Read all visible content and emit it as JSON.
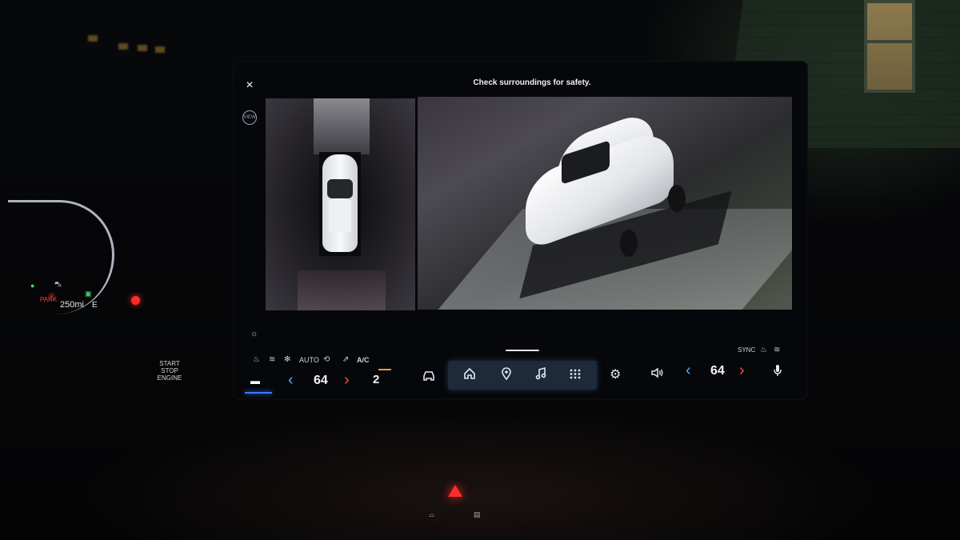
{
  "screen": {
    "message": "Check surroundings for safety.",
    "close_icon": "×",
    "view_toggle_label": "VIEW"
  },
  "climate": {
    "auto_label": "AUTO",
    "ac_label": "A/C",
    "sync_label": "SYNC",
    "driver_temp": "64",
    "passenger_temp": "64",
    "fan_speed": "2"
  },
  "dock": {
    "items": [
      "home-icon",
      "location-pin-icon",
      "music-note-icon",
      "apps-grid-icon"
    ]
  },
  "cluster": {
    "park_label": "PARK",
    "range": "250mi",
    "fuel_label": "E"
  },
  "start_button": {
    "line1": "START",
    "line2": "STOP",
    "line3": "ENGINE"
  },
  "colors": {
    "accent_blue": "#4fa8ff",
    "accent_red": "#ff4a4a",
    "dock_bg": "#1c2a3a",
    "hazard": "#ff2c2c"
  }
}
